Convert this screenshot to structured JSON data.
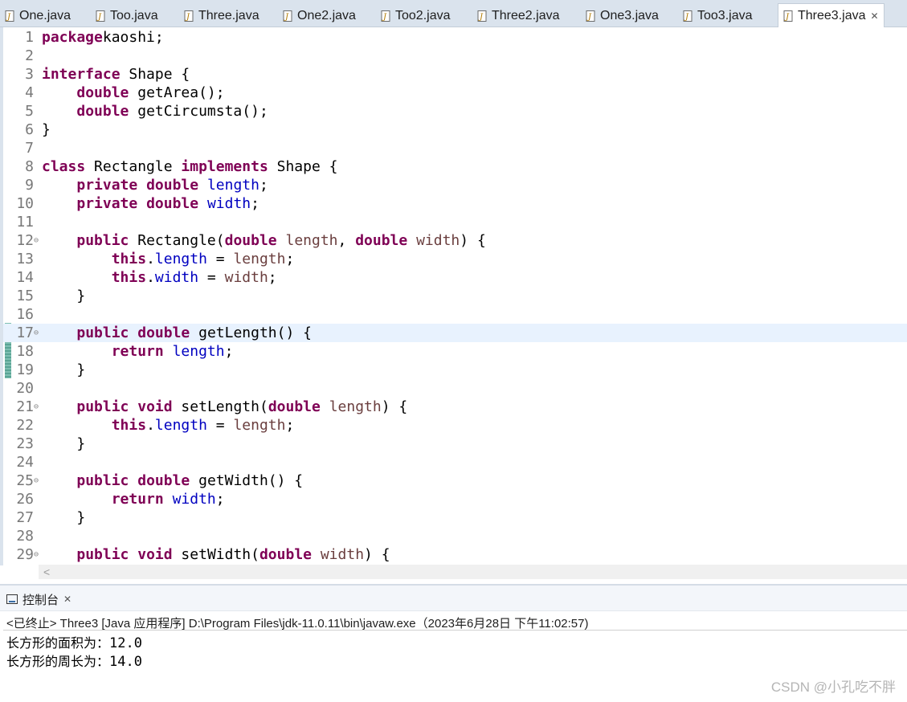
{
  "tabs": [
    {
      "label": "One.java",
      "active": false
    },
    {
      "label": "Too.java",
      "active": false
    },
    {
      "label": "Three.java",
      "active": false
    },
    {
      "label": "One2.java",
      "active": false
    },
    {
      "label": "Too2.java",
      "active": false
    },
    {
      "label": "Three2.java",
      "active": false
    },
    {
      "label": "One3.java",
      "active": false
    },
    {
      "label": "Too3.java",
      "active": false
    },
    {
      "label": "Three3.java",
      "active": true
    }
  ],
  "editor": {
    "current_line": 17,
    "lines": [
      {
        "n": "1",
        "fold": false,
        "tokens": [
          [
            "kw",
            "package"
          ],
          [
            "",
            "kaoshi;"
          ]
        ]
      },
      {
        "n": "2",
        "fold": false,
        "tokens": []
      },
      {
        "n": "3",
        "fold": false,
        "tokens": [
          [
            "kw",
            "interface"
          ],
          [
            "",
            " Shape {"
          ]
        ]
      },
      {
        "n": "4",
        "fold": false,
        "tokens": [
          [
            "",
            "    "
          ],
          [
            "kw",
            "double"
          ],
          [
            "",
            " getArea();"
          ]
        ]
      },
      {
        "n": "5",
        "fold": false,
        "tokens": [
          [
            "",
            "    "
          ],
          [
            "kw",
            "double"
          ],
          [
            "",
            " getCircumsta();"
          ]
        ]
      },
      {
        "n": "6",
        "fold": false,
        "tokens": [
          [
            "",
            "}"
          ]
        ]
      },
      {
        "n": "7",
        "fold": false,
        "tokens": []
      },
      {
        "n": "8",
        "fold": false,
        "tokens": [
          [
            "kw",
            "class"
          ],
          [
            "",
            " Rectangle "
          ],
          [
            "kw",
            "implements"
          ],
          [
            "",
            " Shape {"
          ]
        ]
      },
      {
        "n": "9",
        "fold": false,
        "tokens": [
          [
            "",
            "    "
          ],
          [
            "kw",
            "private"
          ],
          [
            "",
            " "
          ],
          [
            "kw",
            "double"
          ],
          [
            "",
            " "
          ],
          [
            "field",
            "length"
          ],
          [
            "",
            ";"
          ]
        ]
      },
      {
        "n": "10",
        "fold": false,
        "tokens": [
          [
            "",
            "    "
          ],
          [
            "kw",
            "private"
          ],
          [
            "",
            " "
          ],
          [
            "kw",
            "double"
          ],
          [
            "",
            " "
          ],
          [
            "field",
            "width"
          ],
          [
            "",
            ";"
          ]
        ]
      },
      {
        "n": "11",
        "fold": false,
        "tokens": []
      },
      {
        "n": "12",
        "fold": true,
        "tokens": [
          [
            "",
            "    "
          ],
          [
            "kw",
            "public"
          ],
          [
            "",
            " Rectangle("
          ],
          [
            "kw",
            "double"
          ],
          [
            "",
            " "
          ],
          [
            "param",
            "length"
          ],
          [
            "",
            ", "
          ],
          [
            "kw",
            "double"
          ],
          [
            "",
            " "
          ],
          [
            "param",
            "width"
          ],
          [
            "",
            ") {"
          ]
        ]
      },
      {
        "n": "13",
        "fold": false,
        "tokens": [
          [
            "",
            "        "
          ],
          [
            "kw",
            "this"
          ],
          [
            "",
            "."
          ],
          [
            "field",
            "length"
          ],
          [
            "",
            " = "
          ],
          [
            "param",
            "length"
          ],
          [
            "",
            ";"
          ]
        ]
      },
      {
        "n": "14",
        "fold": false,
        "tokens": [
          [
            "",
            "        "
          ],
          [
            "kw",
            "this"
          ],
          [
            "",
            "."
          ],
          [
            "field",
            "width"
          ],
          [
            "",
            " = "
          ],
          [
            "param",
            "width"
          ],
          [
            "",
            ";"
          ]
        ]
      },
      {
        "n": "15",
        "fold": false,
        "tokens": [
          [
            "",
            "    }"
          ]
        ]
      },
      {
        "n": "16",
        "fold": false,
        "tokens": []
      },
      {
        "n": "17",
        "fold": true,
        "tokens": [
          [
            "",
            "    "
          ],
          [
            "kw",
            "public"
          ],
          [
            "",
            " "
          ],
          [
            "kw",
            "double"
          ],
          [
            "",
            " getLength() {"
          ]
        ]
      },
      {
        "n": "18",
        "fold": false,
        "tokens": [
          [
            "",
            "        "
          ],
          [
            "kw",
            "return"
          ],
          [
            "",
            " "
          ],
          [
            "field",
            "length"
          ],
          [
            "",
            ";"
          ]
        ]
      },
      {
        "n": "19",
        "fold": false,
        "tokens": [
          [
            "",
            "    }"
          ]
        ]
      },
      {
        "n": "20",
        "fold": false,
        "tokens": []
      },
      {
        "n": "21",
        "fold": true,
        "tokens": [
          [
            "",
            "    "
          ],
          [
            "kw",
            "public"
          ],
          [
            "",
            " "
          ],
          [
            "kw",
            "void"
          ],
          [
            "",
            " setLength("
          ],
          [
            "kw",
            "double"
          ],
          [
            "",
            " "
          ],
          [
            "param",
            "length"
          ],
          [
            "",
            ") {"
          ]
        ]
      },
      {
        "n": "22",
        "fold": false,
        "tokens": [
          [
            "",
            "        "
          ],
          [
            "kw",
            "this"
          ],
          [
            "",
            "."
          ],
          [
            "field",
            "length"
          ],
          [
            "",
            " = "
          ],
          [
            "param",
            "length"
          ],
          [
            "",
            ";"
          ]
        ]
      },
      {
        "n": "23",
        "fold": false,
        "tokens": [
          [
            "",
            "    }"
          ]
        ]
      },
      {
        "n": "24",
        "fold": false,
        "tokens": []
      },
      {
        "n": "25",
        "fold": true,
        "tokens": [
          [
            "",
            "    "
          ],
          [
            "kw",
            "public"
          ],
          [
            "",
            " "
          ],
          [
            "kw",
            "double"
          ],
          [
            "",
            " getWidth() {"
          ]
        ]
      },
      {
        "n": "26",
        "fold": false,
        "tokens": [
          [
            "",
            "        "
          ],
          [
            "kw",
            "return"
          ],
          [
            "",
            " "
          ],
          [
            "field",
            "width"
          ],
          [
            "",
            ";"
          ]
        ]
      },
      {
        "n": "27",
        "fold": false,
        "tokens": [
          [
            "",
            "    }"
          ]
        ]
      },
      {
        "n": "28",
        "fold": false,
        "tokens": []
      },
      {
        "n": "29",
        "fold": true,
        "tokens": [
          [
            "",
            "    "
          ],
          [
            "kw",
            "public"
          ],
          [
            "",
            " "
          ],
          [
            "kw",
            "void"
          ],
          [
            "",
            " setWidth("
          ],
          [
            "kw",
            "double"
          ],
          [
            "",
            " "
          ],
          [
            "param",
            "width"
          ],
          [
            "",
            ") {"
          ]
        ]
      }
    ]
  },
  "console": {
    "tab_label": "控制台",
    "close_glyph": "✕",
    "status": "<已终止> Three3 [Java 应用程序] D:\\Program Files\\jdk-11.0.11\\bin\\javaw.exe（2023年6月28日 下午11:02:57)",
    "output": [
      {
        "label": "长方形的面积为：",
        "value": "12.0"
      },
      {
        "label": "长方形的周长为：",
        "value": "14.0"
      }
    ]
  },
  "watermark": "CSDN @小孔吃不胖",
  "colors": {
    "keyword": "#7f0055",
    "field": "#0000c0",
    "param": "#6a3e3e",
    "line_number": "#787878"
  }
}
